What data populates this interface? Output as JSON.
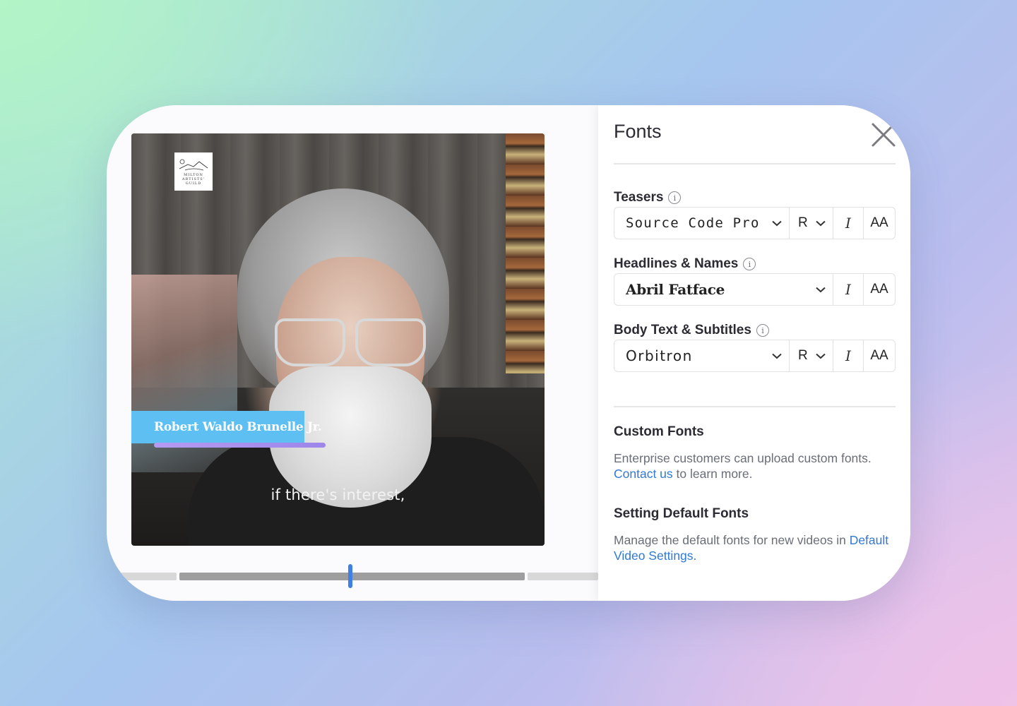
{
  "video": {
    "logo_text": "MILTON ARTISTS' GUILD",
    "name_overlay": "Robert Waldo Brunelle Jr.",
    "subtitle": "if there's interest,"
  },
  "colors": {
    "name_bar": "#5ebff3",
    "name_underline": "#b59bf2",
    "playhead": "#3f7fe6",
    "link": "#2f79d6"
  },
  "panel": {
    "title": "Fonts",
    "close_icon": "close-icon",
    "teasers": {
      "label": "Teasers",
      "font": "Source Code Pro",
      "weight": "R",
      "italic": "I",
      "caps": "AA"
    },
    "headlines": {
      "label": "Headlines & Names",
      "font": "Abril Fatface",
      "italic": "I",
      "caps": "AA"
    },
    "body": {
      "label": "Body Text & Subtitles",
      "font": "Orbitron",
      "weight": "R",
      "italic": "I",
      "caps": "AA"
    },
    "custom": {
      "heading": "Custom Fonts",
      "text_before": "Enterprise customers can upload custom fonts. ",
      "link": "Contact us",
      "text_after": " to learn more."
    },
    "defaults": {
      "heading": "Setting Default Fonts",
      "text_before": "Manage the default fonts for new videos in ",
      "link": "Default Video Settings",
      "text_after": "."
    }
  }
}
